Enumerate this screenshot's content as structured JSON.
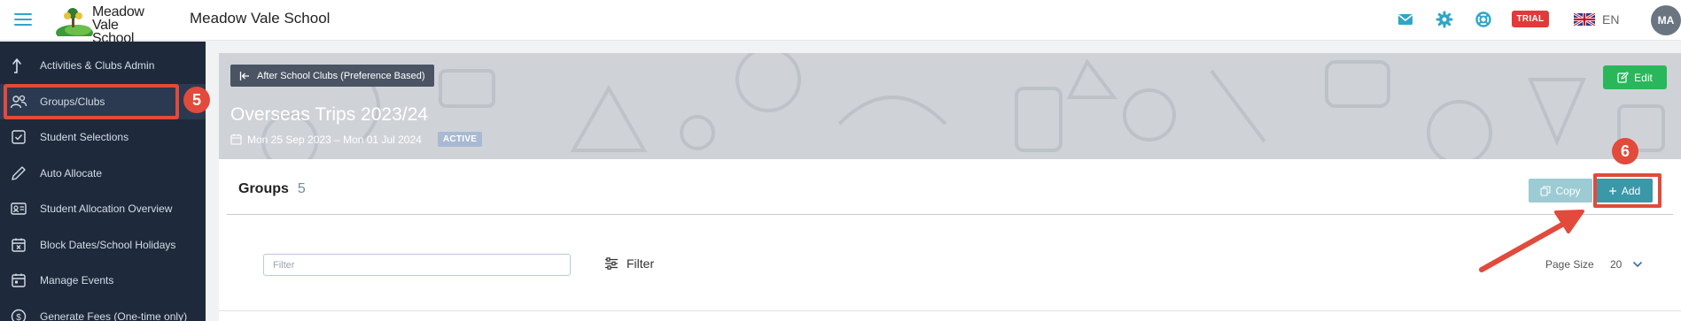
{
  "header": {
    "logo_text_line1": "Meadow",
    "logo_text_line2": "Vale School",
    "school_name": "Meadow Vale School",
    "trial_badge": "TRIAL",
    "language": "EN",
    "avatar_initials": "MA",
    "icons": [
      "mail-icon",
      "gear-icon",
      "help-lifebuoy-icon",
      "uk-flag-icon"
    ],
    "accent_color": "#2ea6c7"
  },
  "sidebar": {
    "items": [
      {
        "label": "Activities & Clubs Admin",
        "icon": "arrow-up-icon"
      },
      {
        "label": "Groups/Clubs",
        "icon": "users-icon",
        "active": true
      },
      {
        "label": "Student Selections",
        "icon": "checkbox-icon"
      },
      {
        "label": "Auto Allocate",
        "icon": "pencil-icon"
      },
      {
        "label": "Student Allocation Overview",
        "icon": "id-card-icon"
      },
      {
        "label": "Block Dates/School Holidays",
        "icon": "calendar-x-icon"
      },
      {
        "label": "Manage Events",
        "icon": "calendar-icon"
      },
      {
        "label": "Generate Fees (One-time only)",
        "icon": "dollar-circle-icon"
      }
    ]
  },
  "annotations": {
    "step5": "5",
    "step6": "6",
    "highlight_color": "#e24a3b"
  },
  "hero": {
    "breadcrumb": "After School Clubs (Preference Based)",
    "edit_label": "Edit",
    "title": "Overseas Trips 2023/24",
    "dates": "Mon 25 Sep 2023 – Mon 01 Jul 2024",
    "status": "ACTIVE"
  },
  "groups": {
    "title": "Groups",
    "count": "5",
    "copy_label": "Copy",
    "add_label": "Add"
  },
  "filter": {
    "placeholder": "Filter",
    "toggle_label": "Filter",
    "page_size_label": "Page Size",
    "page_size_value": "20"
  }
}
